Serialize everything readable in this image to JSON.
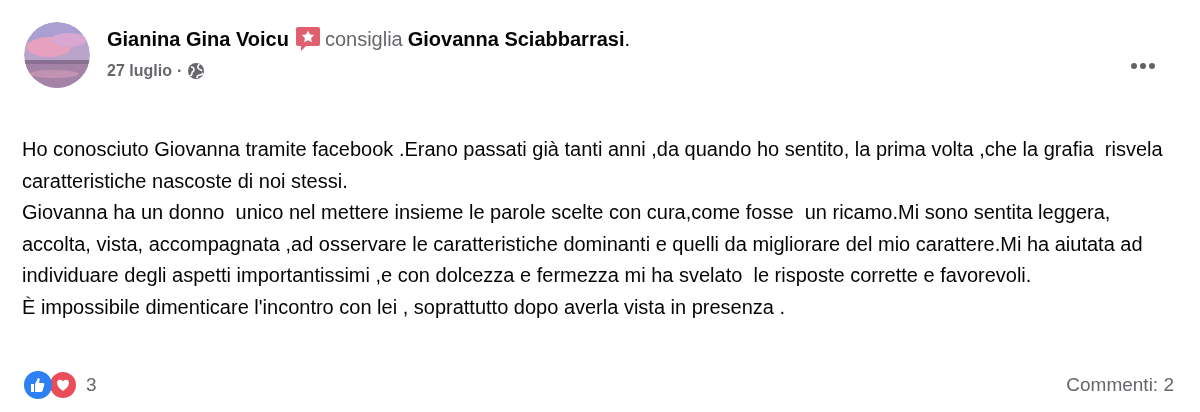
{
  "post": {
    "author": "Gianina Gina Voicu",
    "action": "consiglia",
    "page": "Giovanna Sciabbarrasi",
    "end_mark": ".",
    "date": "27 luglio",
    "separator": "·",
    "body": [
      "Ho conosciuto Giovanna tramite facebook .Erano passati già tanti anni ,da quando ho sentito, la prima volta ,che la grafia  risvela caratteristiche nascoste di noi stessi.",
      "Giovanna ha un donno  unico nel mettere insieme le parole scelte con cura,come fosse  un ricamo.Mi sono sentita leggera, accolta, vista, accompagnata ,ad osservare le caratteristiche dominanti e quelli da migliorare del mio carattere.Mi ha aiutata ad individuare degli aspetti importantissimi ,e con dolcezza e fermezza mi ha svelato  le risposte corrette e favorevoli.",
      "È impossibile dimenticare l'incontro con lei , soprattutto dopo averla vista in presenza ."
    ],
    "reaction_count": "3",
    "comments": "Commenti: 2"
  }
}
